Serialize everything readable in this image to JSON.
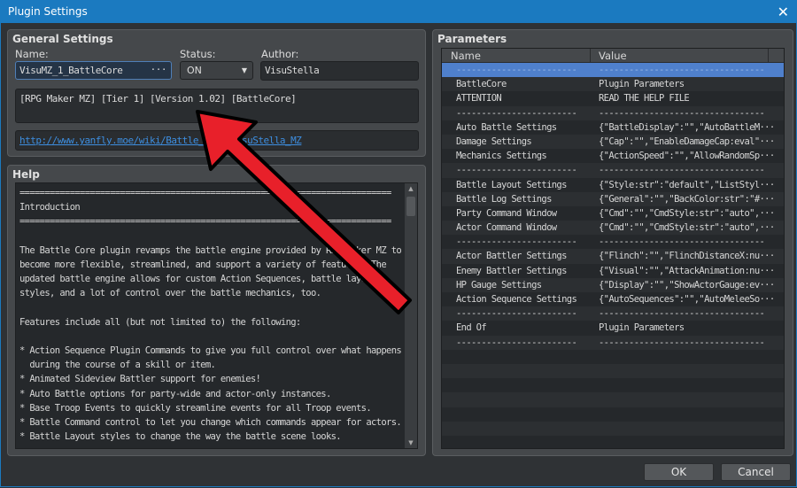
{
  "window": {
    "title": "Plugin Settings",
    "close_icon": "close-icon"
  },
  "general": {
    "title": "General Settings",
    "name_label": "Name:",
    "name_value": "VisuMZ_1_BattleCore",
    "name_button": "···",
    "status_label": "Status:",
    "status_value": "ON",
    "author_label": "Author:",
    "author_value": "VisuStella",
    "description": "[RPG Maker MZ] [Tier 1] [Version 1.02] [BattleCore]",
    "link": "http://www.yanfly.moe/wiki/Battle_Core_VisuStella_MZ"
  },
  "help": {
    "title": "Help",
    "lines": [
      "==========================================================================",
      "Introduction",
      "==========================================================================",
      "",
      "The Battle Core plugin revamps the battle engine provided by RPG Maker MZ to",
      "become more flexible, streamlined, and support a variety of features. The",
      "updated battle engine allows for custom Action Sequences, battle layout",
      "styles, and a lot of control over the battle mechanics, too.",
      "",
      "Features include all (but not limited to) the following:",
      "",
      "* Action Sequence Plugin Commands to give you full control over what happens",
      "  during the course of a skill or item.",
      "* Animated Sideview Battler support for enemies!",
      "* Auto Battle options for party-wide and actor-only instances.",
      "* Base Troop Events to quickly streamline events for all Troop events.",
      "* Battle Command control to let you change which commands appear for actors.",
      "* Battle Layout styles to change the way the battle scene looks."
    ]
  },
  "parameters": {
    "title": "Parameters",
    "columns": [
      "Name",
      "Value"
    ],
    "selected_index": 0,
    "selection_color": "#4f80cc",
    "rows": [
      [
        "------------------------",
        "---------------------------------"
      ],
      [
        "BattleCore",
        "Plugin Parameters"
      ],
      [
        "ATTENTION",
        "READ THE HELP FILE"
      ],
      [
        "------------------------",
        "---------------------------------"
      ],
      [
        "Auto Battle Settings",
        "{\"BattleDisplay\":\"\",\"AutoBattleM···"
      ],
      [
        "Damage Settings",
        "{\"Cap\":\"\",\"EnableDamageCap:eval\"···"
      ],
      [
        "Mechanics Settings",
        "{\"ActionSpeed\":\"\",\"AllowRandomSp···"
      ],
      [
        "------------------------",
        "---------------------------------"
      ],
      [
        "Battle Layout Settings",
        "{\"Style:str\":\"default\",\"ListStyl···"
      ],
      [
        "Battle Log Settings",
        "{\"General\":\"\",\"BackColor:str\":\"#···"
      ],
      [
        "Party Command Window",
        "{\"Cmd\":\"\",\"CmdStyle:str\":\"auto\",···"
      ],
      [
        "Actor Command Window",
        "{\"Cmd\":\"\",\"CmdStyle:str\":\"auto\",···"
      ],
      [
        "------------------------",
        "---------------------------------"
      ],
      [
        "Actor Battler Settings",
        "{\"Flinch\":\"\",\"FlinchDistanceX:nu···"
      ],
      [
        "Enemy Battler Settings",
        "{\"Visual\":\"\",\"AttackAnimation:nu···"
      ],
      [
        "HP Gauge Settings",
        "{\"Display\":\"\",\"ShowActorGauge:ev···"
      ],
      [
        "Action Sequence Settings",
        "{\"AutoSequences\":\"\",\"AutoMeleeSo···"
      ],
      [
        "------------------------",
        "---------------------------------"
      ],
      [
        "End Of",
        "Plugin Parameters"
      ],
      [
        "------------------------",
        "---------------------------------"
      ]
    ]
  },
  "buttons": {
    "ok": "OK",
    "cancel": "Cancel"
  },
  "annotation": {
    "arrow_color": "#e8202a"
  }
}
